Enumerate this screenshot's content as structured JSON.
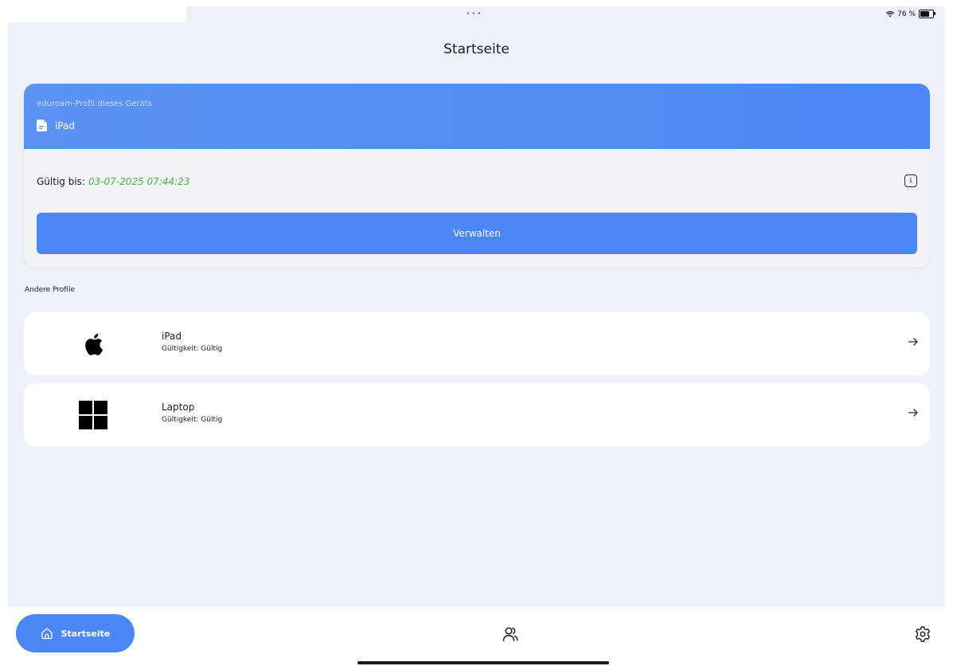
{
  "status_bar": {
    "dots": "•••",
    "battery_text": "76 %",
    "battery_level_percent": 76
  },
  "header": {
    "title": "Startseite"
  },
  "device_card": {
    "caption": "eduroam-Profil dieses Geräts",
    "device_name": "iPad",
    "validity_label": "Gültig bis:",
    "validity_date": "03-07-2025 07:44:23",
    "manage_label": "Verwalten"
  },
  "other_profiles": {
    "section_label": "Andere Profile",
    "items": [
      {
        "name": "iPad",
        "validity": "Gültigkeit: Gültig",
        "os_icon": "apple-icon"
      },
      {
        "name": "Laptop",
        "validity": "Gültigkeit: Gültig",
        "os_icon": "windows-icon"
      }
    ]
  },
  "tab_bar": {
    "home_label": "Startseite"
  },
  "colors": {
    "accent": "#4c86f4",
    "background": "#eef1f9",
    "valid_green": "#4cb050"
  }
}
